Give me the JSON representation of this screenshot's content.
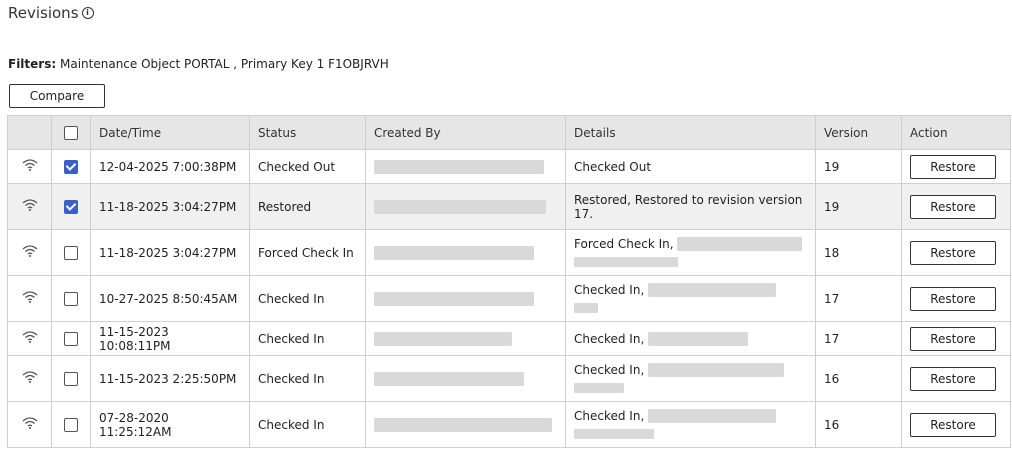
{
  "page": {
    "title": "Revisions",
    "info_icon": "info-icon"
  },
  "filters": {
    "label": "Filters:",
    "text": "Maintenance Object PORTAL , Primary Key 1 F1OBJRVH"
  },
  "toolbar": {
    "compare_label": "Compare"
  },
  "table": {
    "headers": {
      "datetime": "Date/Time",
      "status": "Status",
      "created_by": "Created By",
      "details": "Details",
      "version": "Version",
      "action": "Action"
    },
    "rows": [
      {
        "checked": true,
        "datetime": "12-04-2025 7:00:38PM",
        "status": "Checked Out",
        "details": "Checked Out",
        "version": "19",
        "action": "Restore"
      },
      {
        "checked": true,
        "datetime": "11-18-2025 3:04:27PM",
        "status": "Restored",
        "details": "Restored, Restored to revision version 17.",
        "version": "19",
        "action": "Restore"
      },
      {
        "checked": false,
        "datetime": "11-18-2025 3:04:27PM",
        "status": "Forced Check In",
        "details": "Forced Check In,",
        "version": "18",
        "action": "Restore"
      },
      {
        "checked": false,
        "datetime": "10-27-2025 8:50:45AM",
        "status": "Checked In",
        "details": "Checked In,",
        "version": "17",
        "action": "Restore"
      },
      {
        "checked": false,
        "datetime": "11-15-2023 10:08:11PM",
        "status": "Checked In",
        "details": "Checked In,",
        "version": "17",
        "action": "Restore"
      },
      {
        "checked": false,
        "datetime": "11-15-2023 2:25:50PM",
        "status": "Checked In",
        "details": "Checked In,",
        "version": "16",
        "action": "Restore"
      },
      {
        "checked": false,
        "datetime": "07-28-2020 11:25:12AM",
        "status": "Checked In",
        "details": "Checked In,",
        "version": "16",
        "action": "Restore"
      }
    ]
  },
  "icons": {
    "row_status": "wifi-signal-icon",
    "select": "checkbox-icon"
  }
}
